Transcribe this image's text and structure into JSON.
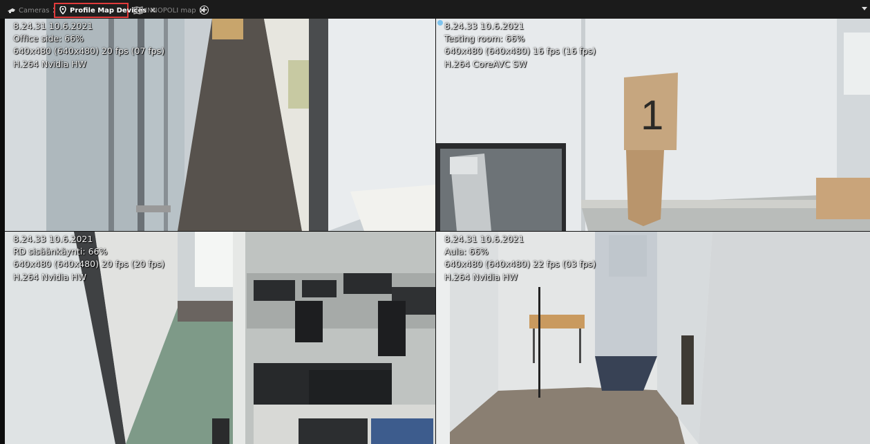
{
  "tabs": [
    {
      "label": "Cameras",
      "icon": "camera-icon",
      "close": "✕",
      "active": false
    },
    {
      "label": "Profile Map Devices",
      "icon": "map-pin-icon",
      "close": "✕",
      "active": true
    },
    {
      "label": "INNOPOLI map",
      "icon": "map-icon",
      "close": "✕",
      "active": false
    }
  ],
  "add_tab_label": "+",
  "colors": {
    "active_tab_outline": "#e23b3b",
    "tabbar_bg": "#1b1b1b",
    "status_dot": "#7fc4ee"
  },
  "cameras": [
    {
      "time": "8.24.31  10.6.2021",
      "name": "Office side: 66%",
      "resolution": "640x480 (640x480) 20 fps (07 fps)",
      "codec": "H.264 Nvidia HW"
    },
    {
      "time": "8.24.33  10.6.2021",
      "name": "Testing room: 66%",
      "resolution": "640x480 (640x480) 16 fps (16 fps)",
      "codec": "H.264 CoreAVC SW"
    },
    {
      "time": "8.24.33  10.6.2021",
      "name": "RD sisäänkäynti: 66%",
      "resolution": "640x480 (640x480) 20 fps (20 fps)",
      "codec": "H.264 Nvidia HW"
    },
    {
      "time": "8.24.31  10.6.2021",
      "name": "Aula: 66%",
      "resolution": "640x480 (640x480) 22 fps (03 fps)",
      "codec": "H.264 Nvidia HW"
    }
  ],
  "scene_text": {
    "sign_number": "1"
  }
}
